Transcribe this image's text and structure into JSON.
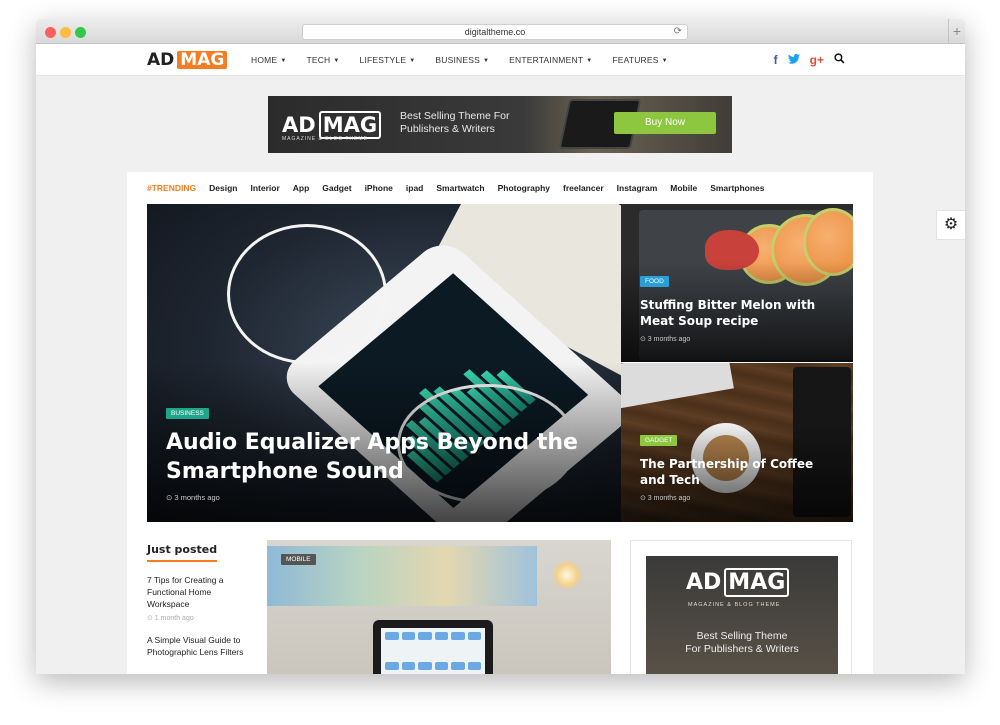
{
  "browser": {
    "url": "digitaltheme.co",
    "reload_icon": "⟳",
    "new_tab_icon": "+"
  },
  "logo": {
    "ad": "AD",
    "mag": "MAG"
  },
  "menu": [
    {
      "label": "HOME"
    },
    {
      "label": "TECH"
    },
    {
      "label": "LIFESTYLE"
    },
    {
      "label": "BUSINESS"
    },
    {
      "label": "ENTERTAINMENT"
    },
    {
      "label": "FEATURES"
    }
  ],
  "menu_caret": "▼",
  "social": {
    "facebook": "f",
    "twitter": "🐦",
    "google": "g+",
    "search": "🔍"
  },
  "banner": {
    "ad": "AD",
    "mag": "MAG",
    "sub": "MAGAZINE & BLOG THEME",
    "line1": "Best Selling Theme For",
    "line2": "Publishers & Writers",
    "button": "Buy Now"
  },
  "trending": {
    "label": "#TRENDING",
    "tags": [
      "Design",
      "Interior",
      "App",
      "Gadget",
      "iPhone",
      "ipad",
      "Smartwatch",
      "Photography",
      "freelancer",
      "Instagram",
      "Mobile",
      "Smartphones"
    ]
  },
  "hero": {
    "category": "BUSINESS",
    "title": "Audio Equalizer Apps Beyond the Smartphone Sound",
    "time": "⊙ 3 months ago"
  },
  "side1": {
    "category": "FOOD",
    "title": "Stuffing Bitter Melon with Meat Soup recipe",
    "time": "⊙ 3 months ago"
  },
  "side2": {
    "category": "GADGET",
    "title": "The Partnership of Coffee and Tech",
    "time": "⊙ 3 months ago"
  },
  "just_posted": {
    "heading": "Just posted",
    "items": [
      {
        "title": "7 Tips for Creating a Functional Home Workspace",
        "time": "⊙ 1 month ago"
      },
      {
        "title": "A Simple Visual Guide to Photographic Lens Filters",
        "time": ""
      }
    ]
  },
  "middle": {
    "category": "MOBILE"
  },
  "ad_side": {
    "ad": "AD",
    "mag": "MAG",
    "sub": "MAGAZINE & BLOG THEME",
    "line1": "Best Selling Theme",
    "line2": "For Publishers & Writers"
  },
  "gear_icon": "⚙",
  "colors": {
    "accent": "#f57c22",
    "business": "#1fa58a",
    "food": "#2a9fd6",
    "gadget": "#8dc63f"
  }
}
